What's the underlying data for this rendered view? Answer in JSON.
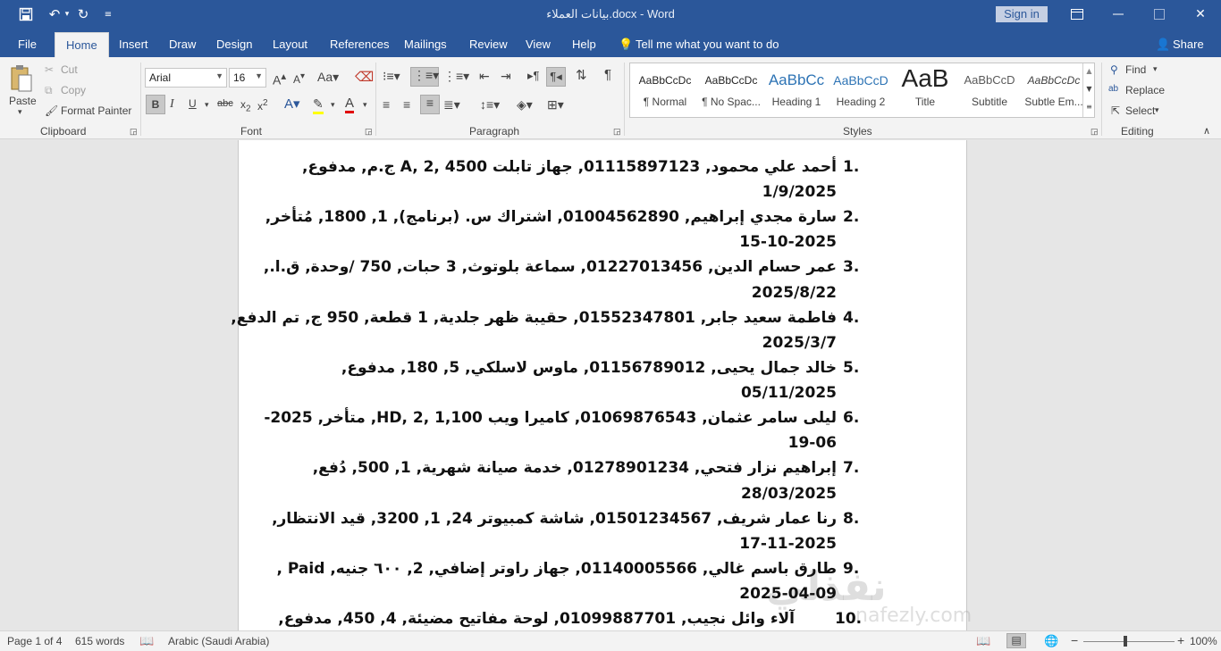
{
  "title_bar": {
    "title": "بيانات العملاء.docx - Word",
    "sign_in": "Sign in"
  },
  "tabs": {
    "file": "File",
    "home": "Home",
    "insert": "Insert",
    "draw": "Draw",
    "design": "Design",
    "layout": "Layout",
    "references": "References",
    "mailings": "Mailings",
    "review": "Review",
    "view": "View",
    "help": "Help",
    "tell_me": "Tell me what you want to do",
    "share": "Share"
  },
  "clipboard": {
    "paste": "Paste",
    "cut": "Cut",
    "copy": "Copy",
    "format_painter": "Format Painter",
    "label": "Clipboard"
  },
  "font": {
    "family": "Arial",
    "size": "16",
    "label": "Font"
  },
  "paragraph": {
    "label": "Paragraph"
  },
  "styles": {
    "label": "Styles",
    "items": [
      {
        "preview": "AaBbCcDc",
        "name": "¶ Normal"
      },
      {
        "preview": "AaBbCcDc",
        "name": "¶ No Spac..."
      },
      {
        "preview": "AaBbCc",
        "name": "Heading 1"
      },
      {
        "preview": "AaBbCcD",
        "name": "Heading 2"
      },
      {
        "preview": "AaB",
        "name": "Title"
      },
      {
        "preview": "AaBbCcD",
        "name": "Subtitle"
      },
      {
        "preview": "AaBbCcDc",
        "name": "Subtle Em..."
      }
    ]
  },
  "editing": {
    "find": "Find",
    "replace": "Replace",
    "select": "Select",
    "label": "Editing"
  },
  "document": {
    "lines": [
      {
        "num": "1.",
        "l1": "أحمد علي محمود, 01115897123, جهاز تابلت A, 2, 4500 ج.م, مدفوع,",
        "l2": "1/9/2025"
      },
      {
        "num": "2.",
        "l1": "سارة مجدي إبراهيم, 01004562890, اشتراك س. (برنامج), 1, 1800, مُتأخر,",
        "l2": "15-10-2025"
      },
      {
        "num": "3.",
        "l1": "عمر حسام الدين, 01227013456, سماعة بلوتوث, 3 حبات, 750 /وحدة, ق.ا.,",
        "l2": "2025/8/22"
      },
      {
        "num": "4.",
        "l1": "فاطمة سعيد جابر, 01552347801, حقيبة ظهر جلدية, 1 قطعة, 950 ج, تم الدفع,",
        "l2": "2025/3/7"
      },
      {
        "num": "5.",
        "l1": "خالد جمال يحيى, 01156789012, ماوس لاسلكي, 5, 180, مدفوع,",
        "l2": "05/11/2025"
      },
      {
        "num": "6.",
        "l1": "ليلى سامر عثمان, 01069876543, كاميرا ويب HD, 2, 1,100, متأخر, 2025-",
        "l2": "19-06"
      },
      {
        "num": "7.",
        "l1": "إبراهيم نزار فتحي, 01278901234, خدمة صيانة شهرية, 1, 500, دُفع,",
        "l2": "28/03/2025"
      },
      {
        "num": "8.",
        "l1": "رنا عمار شريف, 01501234567, شاشة كمبيوتر 24, 1, 3200, قيد الانتظار,",
        "l2": "17-11-2025"
      },
      {
        "num": "9.",
        "l1": "طارق باسم غالي, 01140005566, جهاز راوتر إضافي, 2, ٦٠٠ جنيه, Paid ,",
        "l2": "2025-04-09"
      },
      {
        "num": "10.",
        "l1": "آلاء وائل نجيب, 01099887701, لوحة مفاتيح مضيئة, 4, 450, مدفوع,",
        "l2": ""
      }
    ],
    "watermark": "نفذلي",
    "watermark_url": "nafezly.com"
  },
  "status": {
    "page": "Page 1 of 4",
    "words": "615 words",
    "language": "Arabic (Saudi Arabia)",
    "zoom": "100%"
  }
}
